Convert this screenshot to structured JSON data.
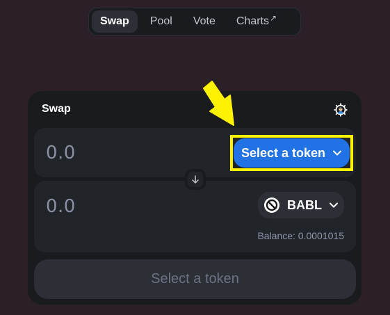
{
  "nav": {
    "tabs": [
      {
        "label": "Swap",
        "active": true
      },
      {
        "label": "Pool"
      },
      {
        "label": "Vote"
      },
      {
        "label": "Charts",
        "external_icon": "↗"
      }
    ]
  },
  "swap": {
    "title": "Swap",
    "settings_icon": "gear-icon",
    "input": {
      "amount_placeholder": "0.0",
      "token_button_label": "Select a token"
    },
    "output": {
      "amount_placeholder": "0.0",
      "token_symbol": "BABL",
      "balance": "Balance: 0.0001015"
    },
    "submit_label": "Select a token"
  },
  "colors": {
    "page_bg": "#2b2028",
    "card_bg": "#191b1f",
    "panel_bg": "#212429",
    "accent": "#2172e5",
    "annotation": "#fff200"
  }
}
